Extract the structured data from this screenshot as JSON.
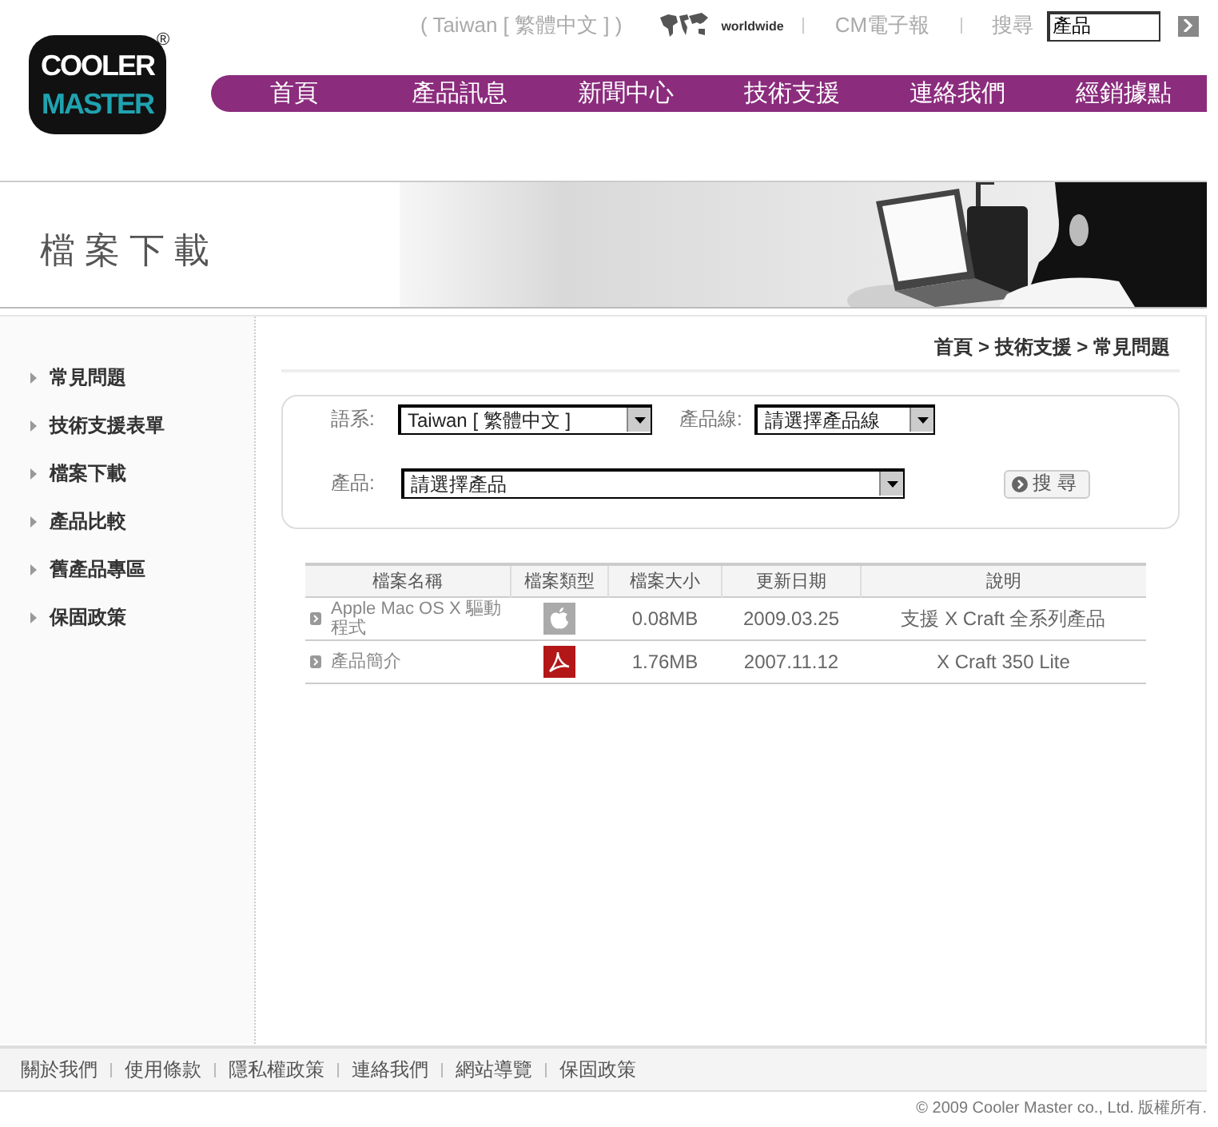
{
  "header": {
    "logo": {
      "line_1": "COOLER",
      "line_2": "MASTER",
      "mark": "®"
    },
    "region": "( Taiwan [ 繁體中文 ] )",
    "worldwide": "worldwide",
    "newsletter": "CM電子報",
    "search": {
      "label": "搜尋",
      "value": "產品"
    }
  },
  "nav": [
    {
      "label": "首頁"
    },
    {
      "label": "產品訊息"
    },
    {
      "label": "新聞中心"
    },
    {
      "label": "技術支援"
    },
    {
      "label": "連絡我們"
    },
    {
      "label": "經銷據點"
    }
  ],
  "banner": {
    "title": "檔案下載"
  },
  "sidebar": {
    "items": [
      "常見問題",
      "技術支援表單",
      "檔案下載",
      "產品比較",
      "舊產品專區",
      "保固政策"
    ]
  },
  "breadcrumb": "首頁 > 技術支援 > 常見問題",
  "filters": {
    "language": {
      "label": "語系:",
      "value": "Taiwan [ 繁體中文 ]"
    },
    "product_line": {
      "label": "產品線:",
      "value": "請選擇產品線"
    },
    "product": {
      "label": "產品:",
      "value": "請選擇產品"
    },
    "search_button": "搜 尋"
  },
  "table": {
    "columns": [
      "檔案名稱",
      "檔案類型",
      "檔案大小",
      "更新日期",
      "說明"
    ],
    "rows": [
      {
        "name": "Apple Mac OS X 驅動程式",
        "kind": "apple",
        "size": "0.08MB",
        "date": "2009.03.25",
        "description": "支援 X Craft 全系列產品"
      },
      {
        "name": "產品簡介",
        "kind": "pdf",
        "size": "1.76MB",
        "date": "2007.11.12",
        "description": "X Craft 350 Lite"
      }
    ]
  },
  "footer": {
    "links": [
      "關於我們",
      "使用條款",
      "隱私權政策",
      "連絡我們",
      "網站導覽",
      "保固政策"
    ],
    "copyright": "© 2009 Cooler Master co., Ltd. 版權所有."
  }
}
